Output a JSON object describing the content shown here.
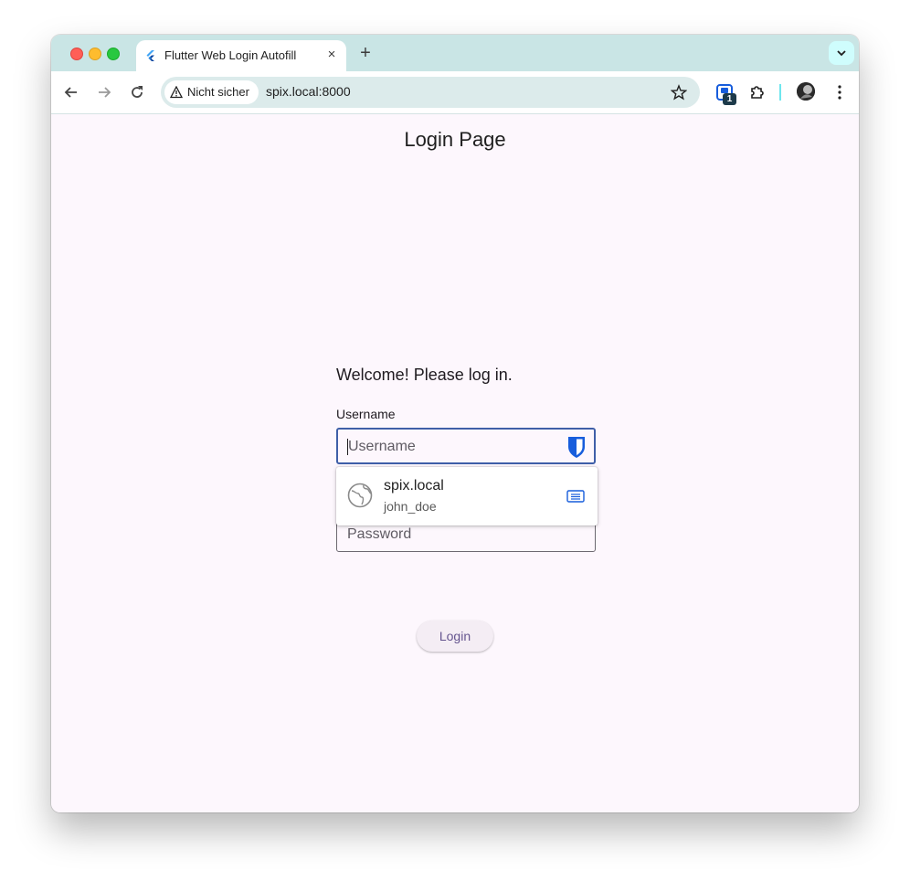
{
  "browser": {
    "tab": {
      "title": "Flutter Web Login Autofill",
      "close": "×"
    },
    "new_tab": "+",
    "address": {
      "security_label": "Nicht sicher",
      "url": "spix.local:8000"
    },
    "extension_badge": "1"
  },
  "page": {
    "title": "Login Page",
    "welcome": "Welcome! Please log in.",
    "username_label": "Username",
    "username_placeholder": "Username",
    "password_placeholder": "Password",
    "login_button": "Login"
  },
  "autofill": {
    "site": "spix.local",
    "username": "john_doe"
  },
  "colors": {
    "accent": "#3f5fa8",
    "page_background": "#fdf7fd",
    "tabstrip": "#c9e5e5",
    "button_text": "#65558f"
  }
}
